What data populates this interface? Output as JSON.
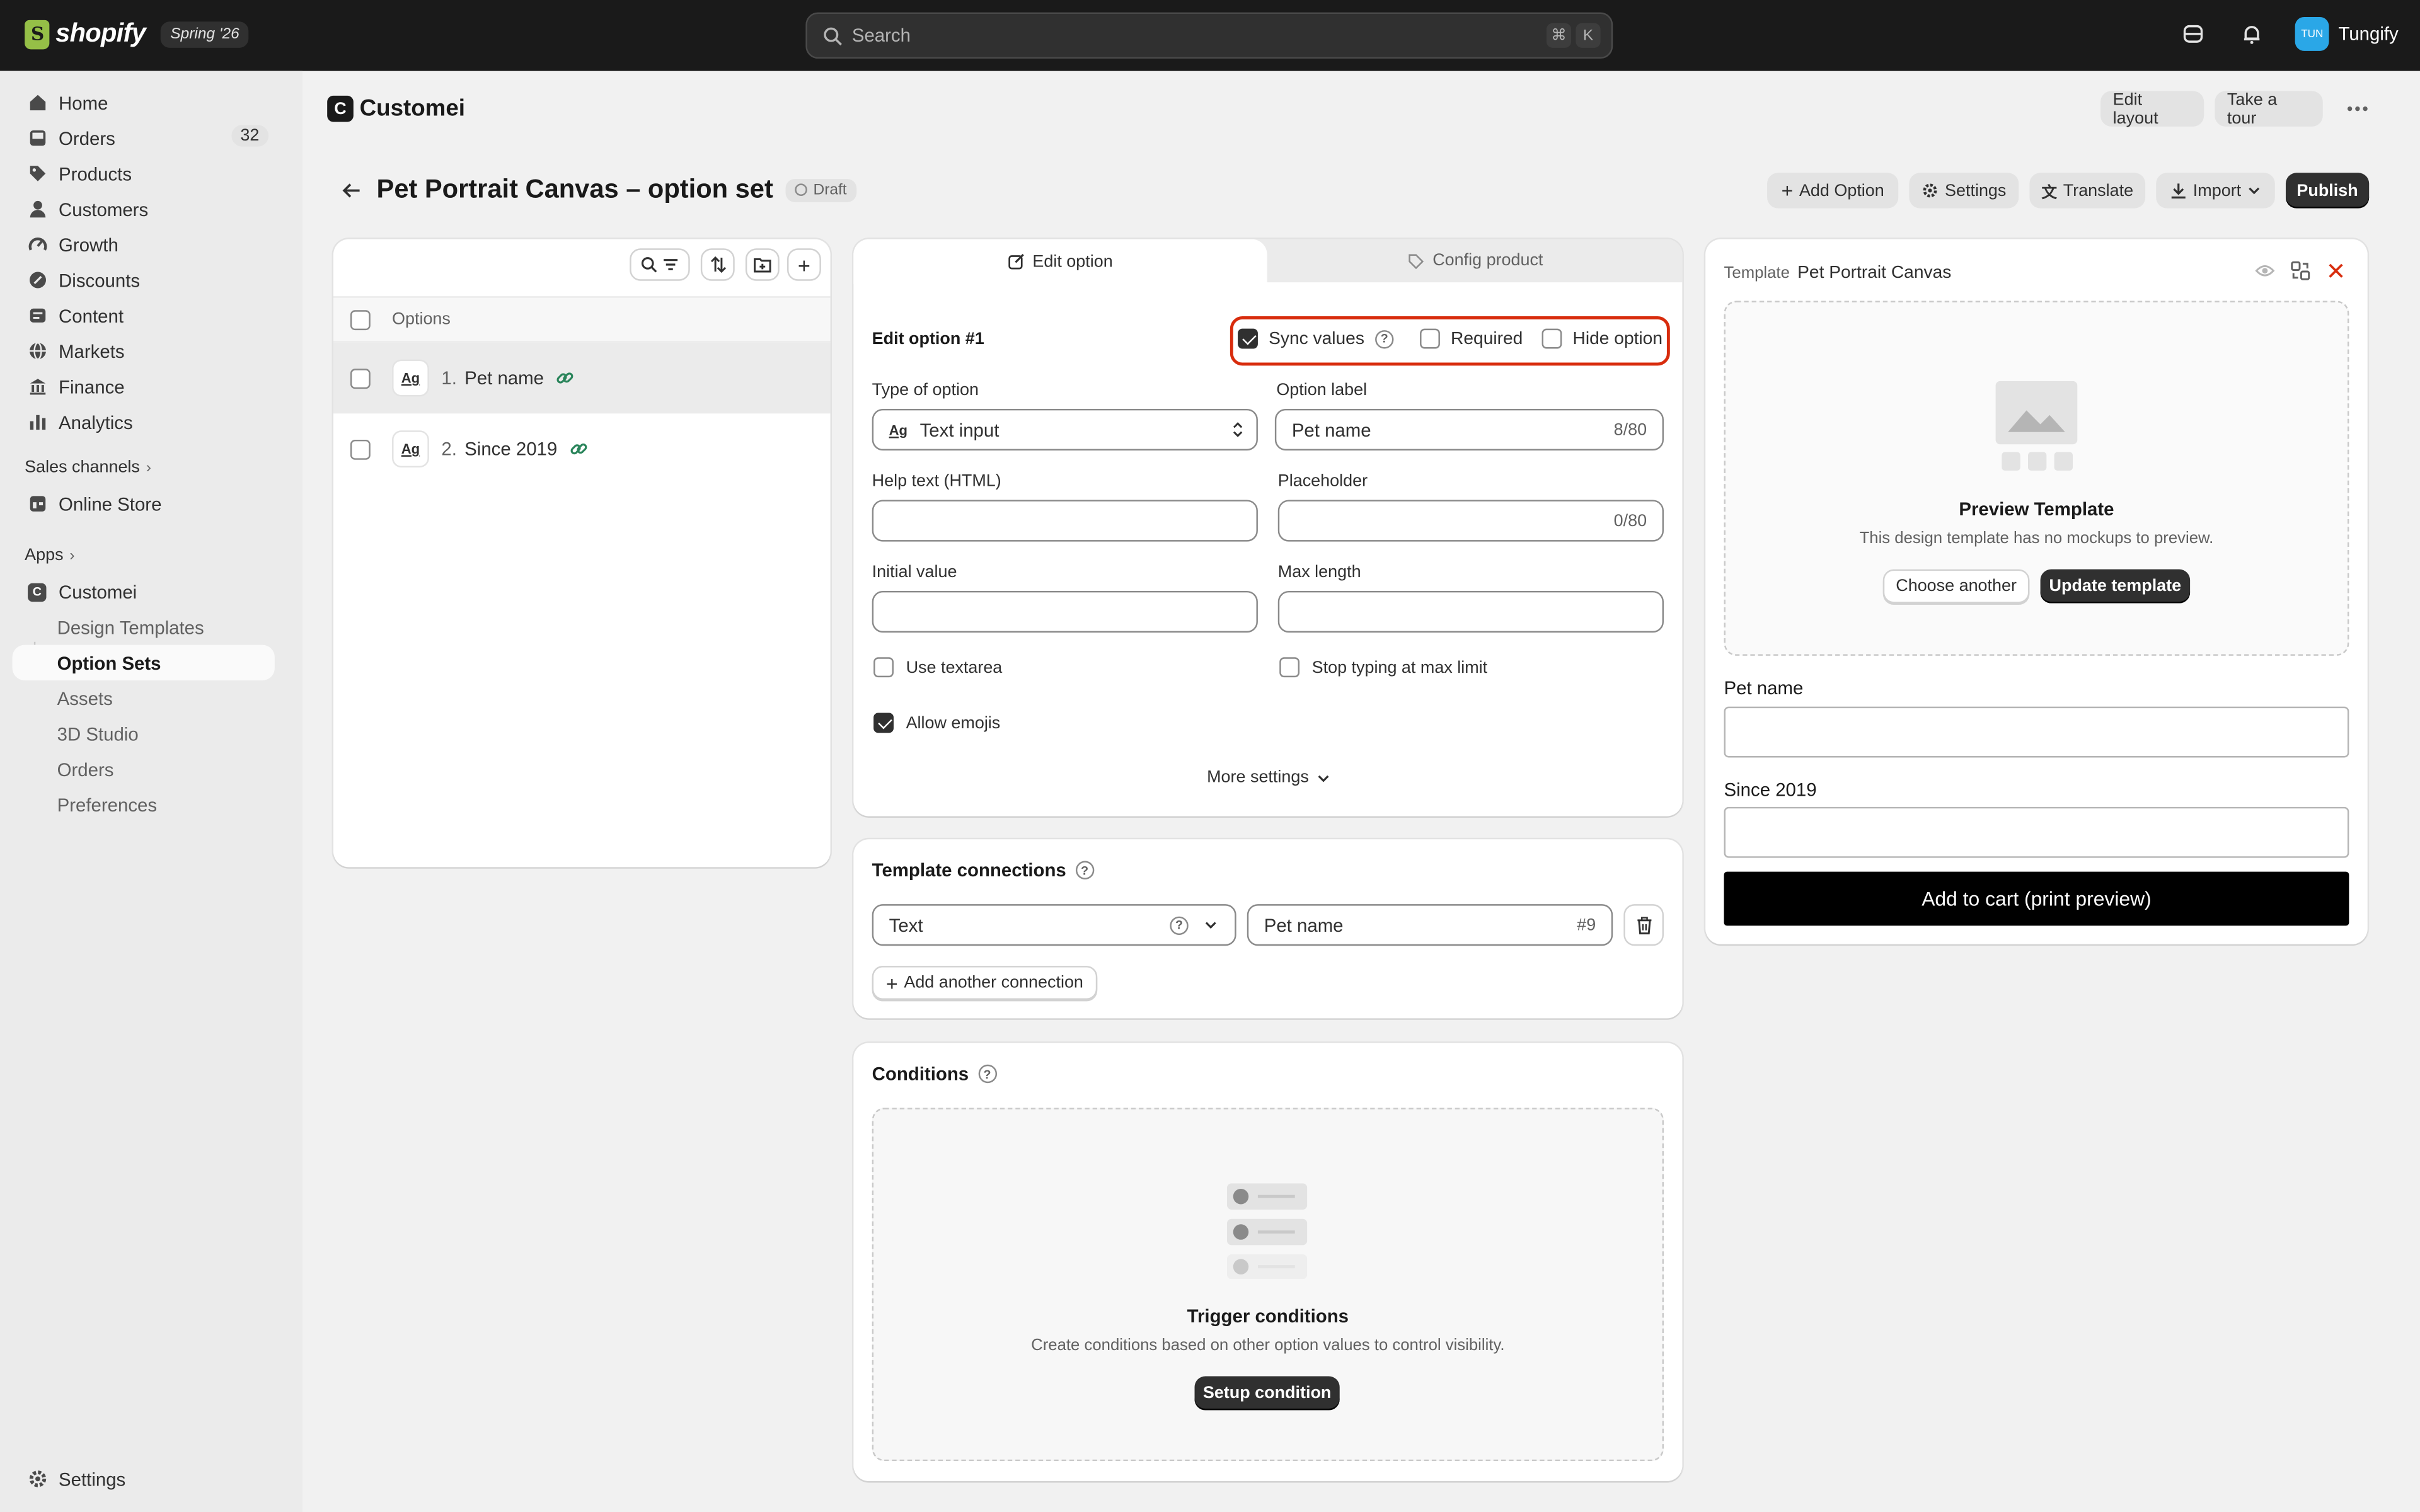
{
  "topbar": {
    "brand": "shopify",
    "edition": "Spring '26",
    "search_placeholder": "Search",
    "shortcut_cmd": "⌘",
    "shortcut_key": "K",
    "user_initials": "TUN",
    "user_name": "Tungify"
  },
  "sidebar": {
    "items": [
      {
        "label": "Home",
        "icon": "home-icon"
      },
      {
        "label": "Orders",
        "icon": "inbox-icon",
        "badge": "32"
      },
      {
        "label": "Products",
        "icon": "tag-icon"
      },
      {
        "label": "Customers",
        "icon": "person-icon"
      },
      {
        "label": "Growth",
        "icon": "gauge-icon"
      },
      {
        "label": "Discounts",
        "icon": "discount-icon"
      },
      {
        "label": "Content",
        "icon": "content-icon"
      },
      {
        "label": "Markets",
        "icon": "globe-icon"
      },
      {
        "label": "Finance",
        "icon": "bank-icon"
      },
      {
        "label": "Analytics",
        "icon": "chart-icon"
      }
    ],
    "sales_channels_label": "Sales channels",
    "online_store_label": "Online Store",
    "apps_label": "Apps",
    "app_name": "Customei",
    "app_subitems": [
      "Design Templates",
      "Option Sets",
      "Assets",
      "3D Studio",
      "Orders",
      "Preferences"
    ],
    "active_subitem": "Option Sets",
    "settings_label": "Settings"
  },
  "app_header": {
    "logo_letter": "C",
    "title": "Customei",
    "edit_layout": "Edit layout",
    "take_tour": "Take a tour"
  },
  "page": {
    "title": "Pet Portrait Canvas – option set",
    "status": "Draft",
    "actions": {
      "add_option": "Add Option",
      "settings": "Settings",
      "translate": "Translate",
      "import": "Import",
      "publish": "Publish"
    }
  },
  "options_list": {
    "header": "Options",
    "rows": [
      {
        "index": "1.",
        "name": "Pet name",
        "type_icon": "Ag"
      },
      {
        "index": "2.",
        "name": "Since 2019",
        "type_icon": "Ag"
      }
    ]
  },
  "editor": {
    "tabs": {
      "edit": "Edit option",
      "config": "Config product"
    },
    "heading": "Edit option #1",
    "sync_values": "Sync values",
    "required": "Required",
    "hide_option": "Hide option",
    "type_label": "Type of option",
    "type_value": "Text input",
    "option_label_label": "Option label",
    "option_label_value": "Pet name",
    "option_label_count": "8/80",
    "help_text_label": "Help text (HTML)",
    "placeholder_label": "Placeholder",
    "placeholder_count": "0/80",
    "initial_value_label": "Initial value",
    "max_length_label": "Max length",
    "use_textarea": "Use textarea",
    "stop_typing": "Stop typing at max limit",
    "allow_emojis": "Allow emojis",
    "more_settings": "More settings"
  },
  "connections": {
    "title": "Template connections",
    "type_value": "Text",
    "target_value": "Pet name",
    "target_id": "#9",
    "add_button": "Add another connection"
  },
  "conditions": {
    "title": "Conditions",
    "empty_title": "Trigger conditions",
    "empty_desc": "Create conditions based on other option values to control visibility.",
    "setup_button": "Setup condition"
  },
  "preview": {
    "template_label": "Template",
    "template_name": "Pet Portrait Canvas",
    "preview_title": "Preview Template",
    "preview_desc": "This design template has no mockups to preview.",
    "choose_another": "Choose another",
    "update_template": "Update template",
    "field1_label": "Pet name",
    "field2_label": "Since 2019",
    "add_to_cart": "Add to cart (print preview)"
  },
  "colors": {
    "highlight": "#d82c0d",
    "link_green": "#29845a",
    "avatar": "#2aa7e7"
  }
}
